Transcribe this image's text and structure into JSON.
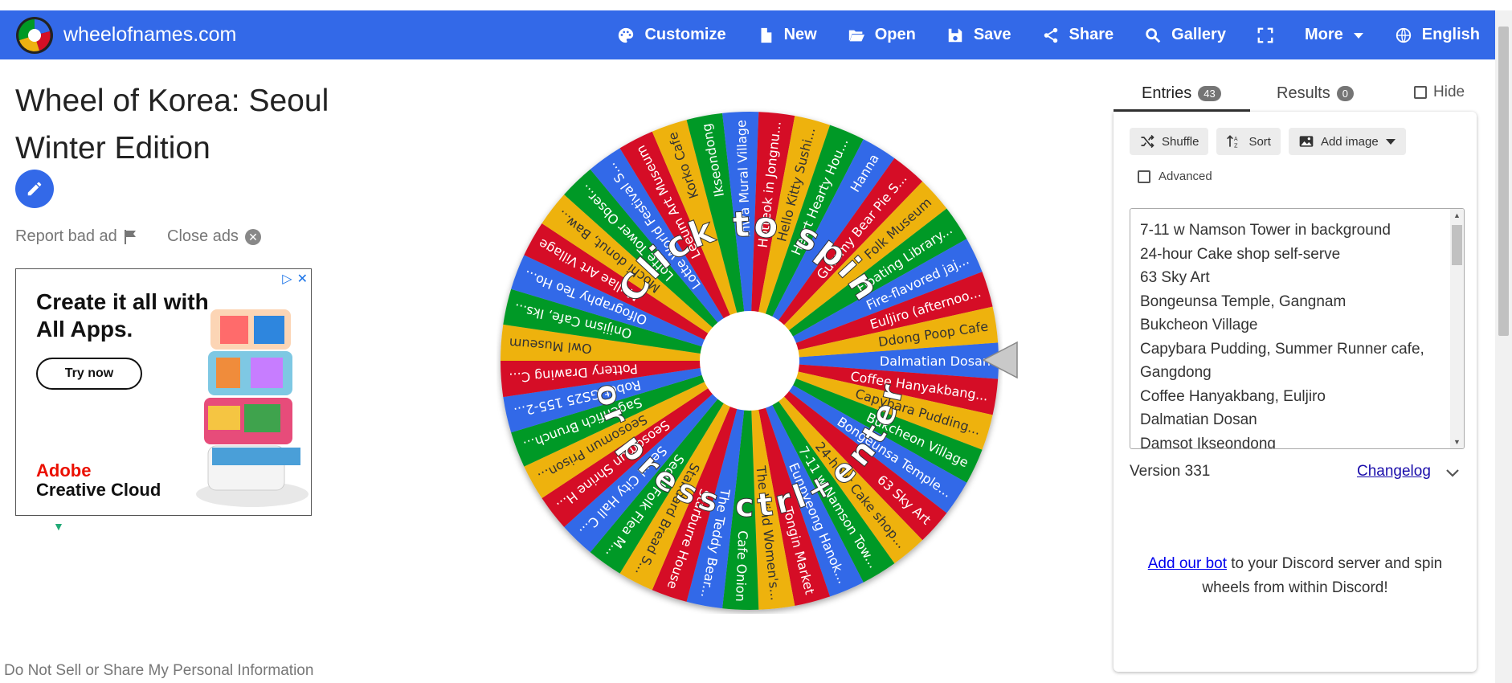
{
  "nav": {
    "brand": "wheelofnames.com",
    "items": [
      {
        "label": "Customize",
        "icon": "palette-icon"
      },
      {
        "label": "New",
        "icon": "new-file-icon"
      },
      {
        "label": "Open",
        "icon": "folder-open-icon"
      },
      {
        "label": "Save",
        "icon": "save-icon"
      },
      {
        "label": "Share",
        "icon": "share-icon"
      },
      {
        "label": "Gallery",
        "icon": "search-icon"
      },
      {
        "label": "",
        "icon": "fullscreen-icon"
      },
      {
        "label": "More",
        "icon": "caret-down-icon"
      },
      {
        "label": "English",
        "icon": "globe-icon"
      }
    ]
  },
  "page": {
    "title": "Wheel of Korea: Seoul Winter Edition",
    "report_bad_ad": "Report bad ad",
    "close_ads": "Close ads",
    "do_not_sell": "Do Not Sell or Share My Personal Information"
  },
  "ad": {
    "headline": "Create it all with All Apps.",
    "cta": "Try now",
    "brand_line1": "Adobe",
    "brand_line2": "Creative Cloud"
  },
  "wheel": {
    "top_text": "Click to spin",
    "bottom_text": "or press ctrl+enter",
    "colors": [
      "#3369e8",
      "#d50f25",
      "#eeb211",
      "#009925"
    ],
    "segments": [
      "Dalmatian Dosan",
      "Coffee Hanyakbang...",
      "Capybara Pudding...",
      "Bukcheon Village",
      "Bongeunsa Temple...",
      "63 Sky Art",
      "24-hour Cake shop...",
      "7-11 w Namson Tow...",
      "Eunpyeong Hanok...",
      "Tongin Market",
      "The Wind Women's...",
      "Cafe Onion",
      "The Teddy Bear...",
      "Starburre House",
      "Standard Bread S...",
      "Seoul Folk Flea M...",
      "Seoul City Hall C...",
      "Seosomun Shrine H...",
      "Seosomun Prison...",
      "Sagenfich Brunch...",
      "Robot GS25 155-2...",
      "Pottery Drawing C...",
      "Owl Museum",
      "Onijism Cafe, Iks...",
      "Olfography Teo Ho...",
      "Mullae Art Village",
      "Mochi donut, Baw...",
      "Lotte Tower Obser...",
      "Lotte World Festival S...",
      "Leeum Art Museum",
      "Korko Cafe",
      "Ikseondong",
      "Ihwa Mural Village",
      "Hotteok in Jongnu...",
      "Hello Kitty Sushi...",
      "Heart Hearty Hou...",
      "Hanna",
      "Gummy Bear Pie S...",
      "Folk Museum",
      "Floating Library...",
      "Fire-flavored jaj...",
      "Euljiro (afternoo...",
      "Ddong Poop Cafe"
    ]
  },
  "panel": {
    "tab_entries": "Entries",
    "entries_count": "43",
    "tab_results": "Results",
    "results_count": "0",
    "hide": "Hide",
    "shuffle": "Shuffle",
    "sort": "Sort",
    "add_image": "Add image",
    "advanced": "Advanced",
    "entries": [
      "7-11 w Namson Tower in background",
      "24-hour Cake shop self-serve",
      "63 Sky Art",
      "Bongeunsa Temple, Gangnam",
      "Bukcheon Village",
      "Capybara Pudding, Summer Runner cafe, Gangdong",
      "Coffee Hanyakbang, Euljiro",
      "Dalmatian Dosan",
      "Damsot Ikseondong"
    ],
    "version": "Version 331",
    "changelog": "Changelog",
    "discord_link": "Add our bot",
    "discord_rest": " to your Discord server and spin wheels from within Discord!"
  }
}
